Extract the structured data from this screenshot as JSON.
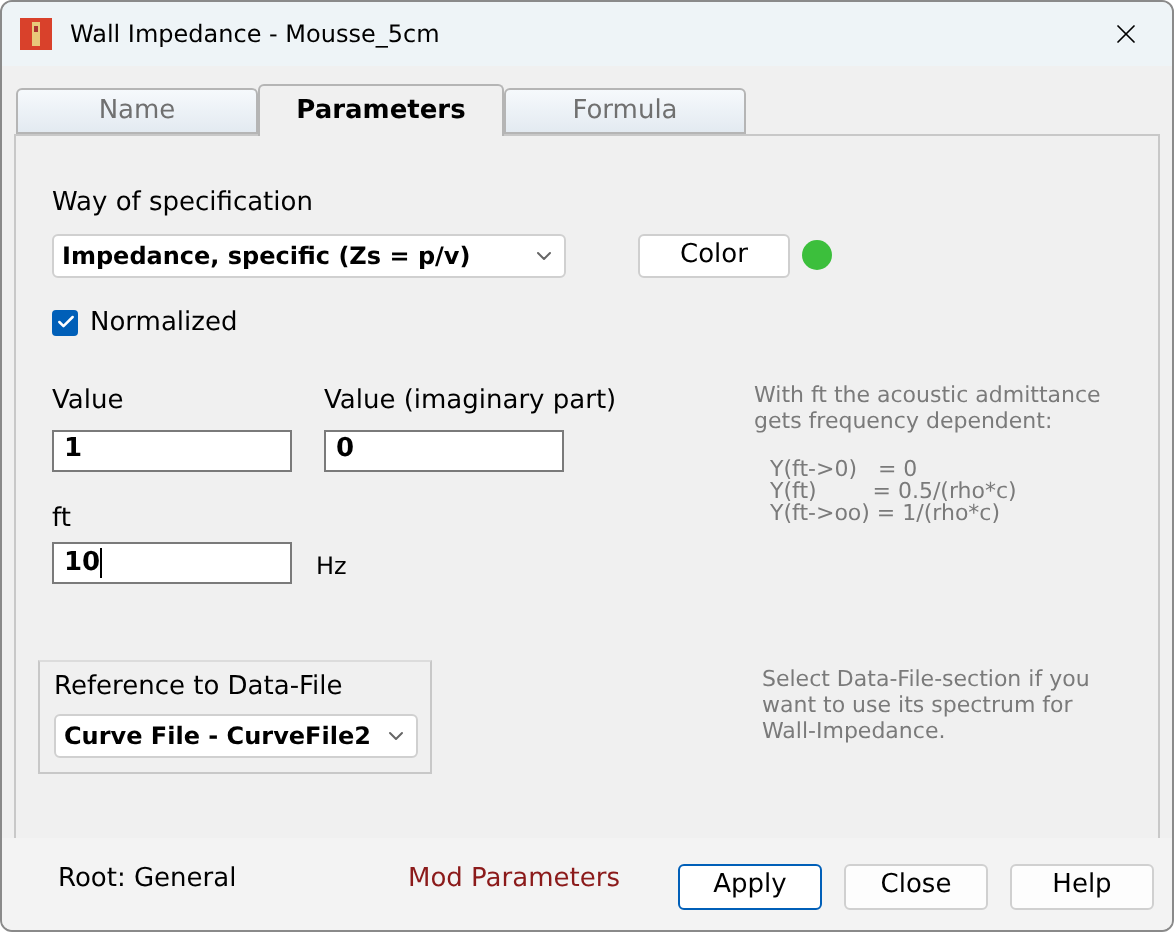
{
  "window": {
    "title": "Wall Impedance - Mousse_5cm"
  },
  "tabs": [
    {
      "label": "Name",
      "selected": false
    },
    {
      "label": "Parameters",
      "selected": true
    },
    {
      "label": "Formula",
      "selected": false
    }
  ],
  "specification": {
    "label": "Way of specification",
    "value": "Impedance, specific (Zs = p/v)"
  },
  "color_button": {
    "label": "Color",
    "color": "#3cbf3c"
  },
  "normalized": {
    "label": "Normalized",
    "checked": true
  },
  "value": {
    "label": "Value",
    "value": "1"
  },
  "value_imaginary": {
    "label": "Value (imaginary part)",
    "value": "0"
  },
  "ft": {
    "label": "ft",
    "value": "10",
    "unit": "Hz"
  },
  "admittance_note": {
    "text": "With ft the acoustic admittance gets frequency dependent:",
    "formula": [
      "Y(ft->0)   = 0",
      "Y(ft)        = 0.5/(rho*c)",
      "Y(ft->oo) = 1/(rho*c)"
    ]
  },
  "data_file": {
    "label": "Reference to Data-File",
    "value": "Curve File - CurveFile2"
  },
  "data_file_note": "Select Data-File-section if you want to use its spectrum for Wall-Impedance.",
  "status": {
    "root": "Root: General",
    "mode": "Mod Parameters"
  },
  "buttons": [
    {
      "label": "Apply",
      "default": true
    },
    {
      "label": "Close",
      "default": false
    },
    {
      "label": "Help",
      "default": false
    }
  ]
}
